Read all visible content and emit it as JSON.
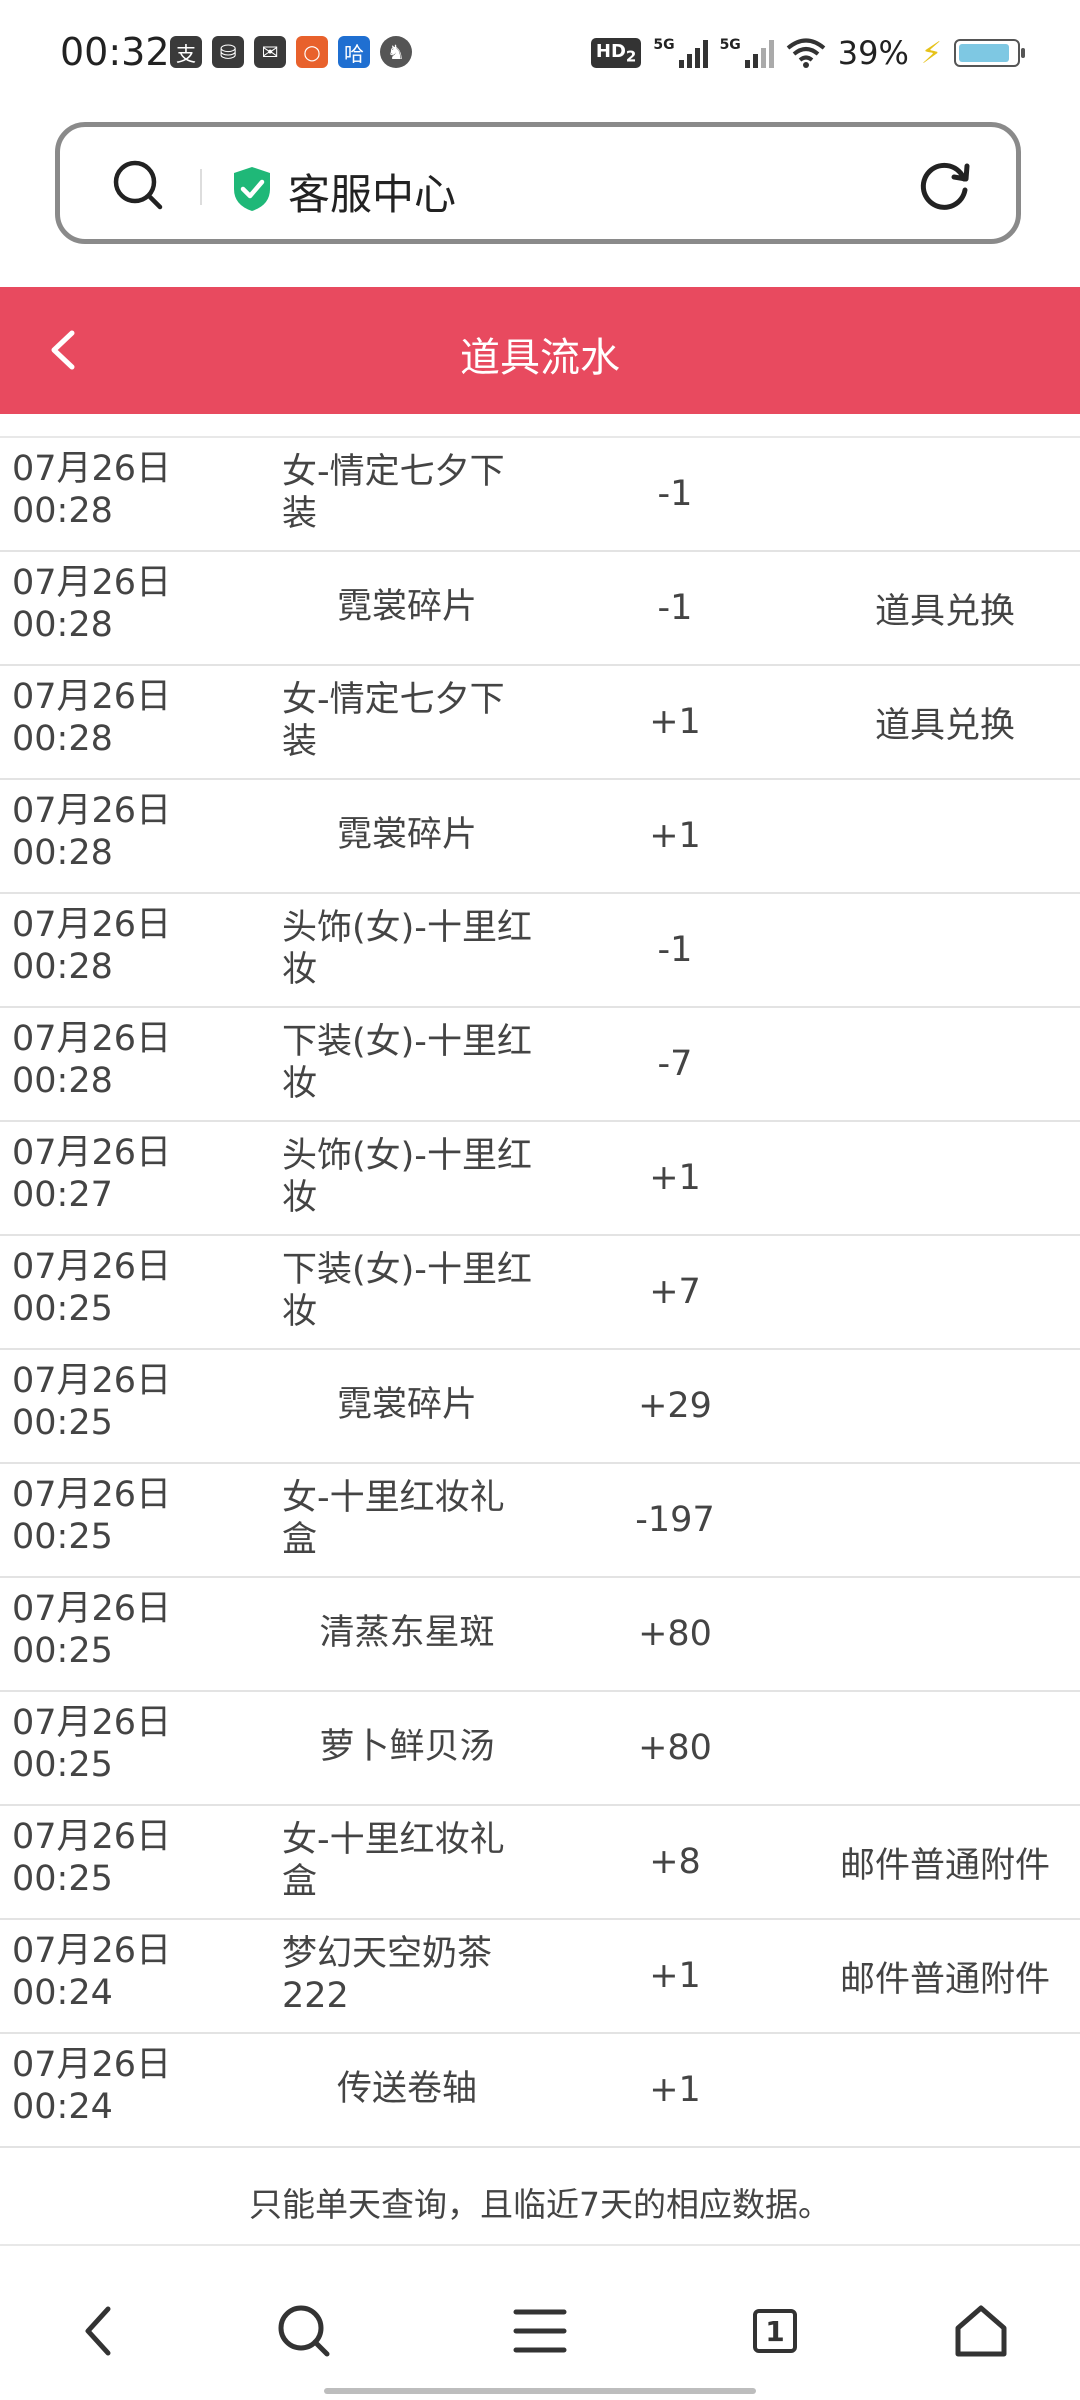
{
  "status_bar": {
    "time": "00:32",
    "app_icons": [
      "支",
      "⛁",
      "✉",
      "○",
      "哈",
      "♞"
    ],
    "hd_badge": "HD",
    "hd_sub": "2",
    "net1": "5G",
    "net2": "5G",
    "battery": "39%",
    "battery_level": 0.39
  },
  "address_bar": {
    "text": "客服中心",
    "shield_color": "#1fb878"
  },
  "header": {
    "title": "道具流水",
    "color": "#e84a5f"
  },
  "rows": [
    {
      "time1": "07月26日",
      "time2": "00:28",
      "name": "女-情定七夕下装",
      "delta": "-1",
      "source": ""
    },
    {
      "time1": "07月26日",
      "time2": "00:28",
      "name": "霓裳碎片",
      "delta": "-1",
      "source": "道具兑换"
    },
    {
      "time1": "07月26日",
      "time2": "00:28",
      "name": "女-情定七夕下装",
      "delta": "+1",
      "source": "道具兑换"
    },
    {
      "time1": "07月26日",
      "time2": "00:28",
      "name": "霓裳碎片",
      "delta": "+1",
      "source": ""
    },
    {
      "time1": "07月26日",
      "time2": "00:28",
      "name": "头饰(女)-十里红妆",
      "delta": "-1",
      "source": ""
    },
    {
      "time1": "07月26日",
      "time2": "00:28",
      "name": "下装(女)-十里红妆",
      "delta": "-7",
      "source": ""
    },
    {
      "time1": "07月26日",
      "time2": "00:27",
      "name": "头饰(女)-十里红妆",
      "delta": "+1",
      "source": ""
    },
    {
      "time1": "07月26日",
      "time2": "00:25",
      "name": "下装(女)-十里红妆",
      "delta": "+7",
      "source": ""
    },
    {
      "time1": "07月26日",
      "time2": "00:25",
      "name": "霓裳碎片",
      "delta": "+29",
      "source": ""
    },
    {
      "time1": "07月26日",
      "time2": "00:25",
      "name": "女-十里红妆礼盒",
      "delta": "-197",
      "source": ""
    },
    {
      "time1": "07月26日",
      "time2": "00:25",
      "name": "清蒸东星斑",
      "delta": "+80",
      "source": ""
    },
    {
      "time1": "07月26日",
      "time2": "00:25",
      "name": "萝卜鲜贝汤",
      "delta": "+80",
      "source": ""
    },
    {
      "time1": "07月26日",
      "time2": "00:25",
      "name": "女-十里红妆礼盒",
      "delta": "+8",
      "source": "邮件普通附件"
    },
    {
      "time1": "07月26日",
      "time2": "00:24",
      "name": "梦幻天空奶茶222",
      "delta": "+1",
      "source": "邮件普通附件"
    },
    {
      "time1": "07月26日",
      "time2": "00:24",
      "name": "传送卷轴",
      "delta": "+1",
      "source": ""
    }
  ],
  "footer_note": "只能单天查询，且临近7天的相应数据。",
  "bottom_nav": {
    "tab_count": "1"
  }
}
